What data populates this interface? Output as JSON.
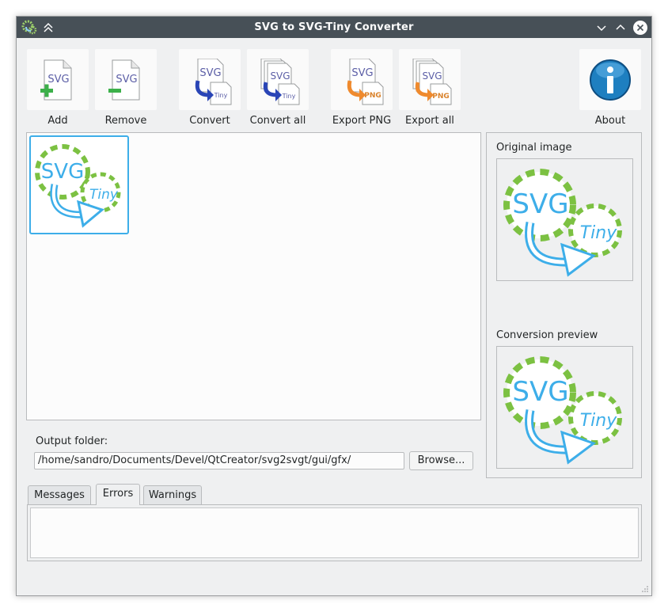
{
  "window": {
    "title": "SVG to SVG-Tiny Converter"
  },
  "toolbar": {
    "add": "Add",
    "remove": "Remove",
    "convert": "Convert",
    "convert_all": "Convert all",
    "export_png": "Export PNG",
    "export_all": "Export all",
    "about": "About"
  },
  "icon_text": {
    "svg": "SVG",
    "tiny": "Tiny",
    "png": "PNG"
  },
  "side": {
    "original_label": "Original image",
    "preview_label": "Conversion preview"
  },
  "output": {
    "label": "Output folder:",
    "path": "/home/sandro/Documents/Devel/QtCreator/svg2svgt/gui/gfx/",
    "browse": "Browse..."
  },
  "tabs": {
    "messages": "Messages",
    "errors": "Errors",
    "warnings": "Warnings",
    "active": "Errors"
  },
  "colors": {
    "titlebar": "#475057",
    "selection": "#3daee9",
    "gear": "#7cc142",
    "arrow_blue": "#3daee9",
    "about_blue": "#1e7fc0"
  }
}
